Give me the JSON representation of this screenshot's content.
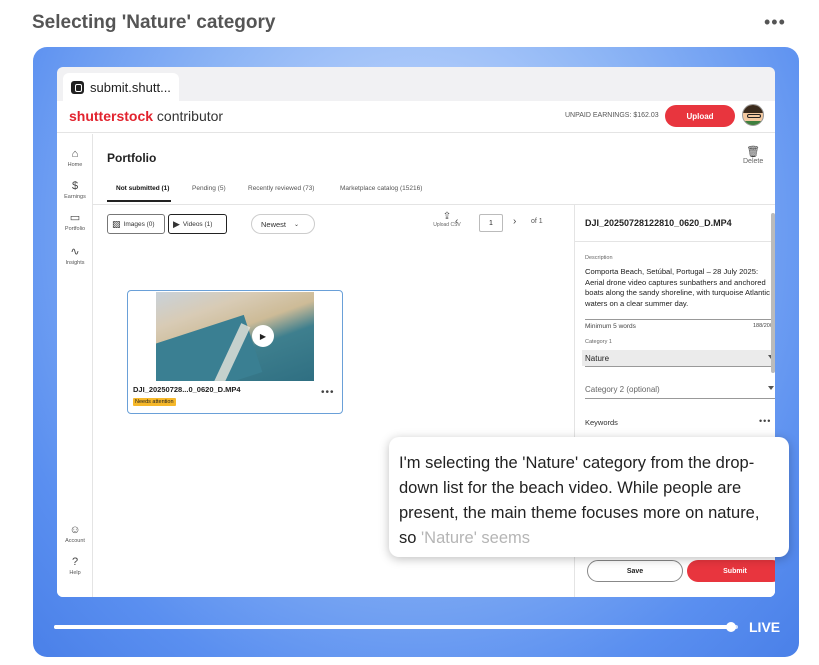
{
  "header": {
    "title": "Selecting 'Nature' category",
    "more_icon": "more-horizontal-icon"
  },
  "browser": {
    "tab_title": "submit.shutt..."
  },
  "app": {
    "brand_red": "shutterstock",
    "brand_rest": " contributor",
    "earnings_label": "UNPAID EARNINGS: $162.03",
    "upload_label": "Upload"
  },
  "sidebar": {
    "items": [
      {
        "label": "Home",
        "icon": "⌂"
      },
      {
        "label": "Earnings",
        "icon": "$"
      },
      {
        "label": "Portfolio",
        "icon": "▭"
      },
      {
        "label": "Insights",
        "icon": "∿"
      }
    ],
    "bottom_items": [
      {
        "label": "Account",
        "icon": "☺"
      },
      {
        "label": "Help",
        "icon": "?"
      }
    ]
  },
  "portfolio": {
    "title": "Portfolio",
    "delete_label": "Delete",
    "tabs": [
      {
        "label": "Not submitted (1)"
      },
      {
        "label": "Pending (5)"
      },
      {
        "label": "Recently reviewed (73)"
      },
      {
        "label": "Marketplace catalog (15216)"
      }
    ],
    "filters": {
      "images": "Images (0)",
      "videos": "Videos (1)"
    },
    "sort": "Newest",
    "upload_csv": "Upload CSV",
    "pager": {
      "page": "1",
      "of": "of 1"
    },
    "card": {
      "name": "DJI_20250728...0_0620_D.MP4",
      "badge": "Needs attention"
    }
  },
  "detail": {
    "filename": "DJI_20250728122810_0620_D.MP4",
    "description_label": "Description",
    "description": "Comporta Beach, Setúbal, Portugal – 28 July 2025: Aerial drone video captures sunbathers and anchored boats along the sandy shoreline, with turquoise Atlantic waters on a clear summer day.",
    "min_words": "Minimum 5 words",
    "char_count": "188/200",
    "category1_label": "Category 1",
    "category1_value": "Nature",
    "category2_placeholder": "Category 2 (optional)",
    "keywords_label": "Keywords",
    "save_label": "Save",
    "submit_label": "Submit"
  },
  "tooltip": {
    "text": "I'm selecting the 'Nature' category from the drop-down list for the beach video. While people are present, the main theme focuses more on nature, so ",
    "text_faded": "'Nature' seems"
  },
  "playback": {
    "progress": 0.99,
    "live_label": "LIVE"
  },
  "colors": {
    "brand_red": "#e2232e",
    "button_red": "#e8353e",
    "link_blue": "#6aa0d8",
    "badge_yellow": "#f6b82a"
  }
}
